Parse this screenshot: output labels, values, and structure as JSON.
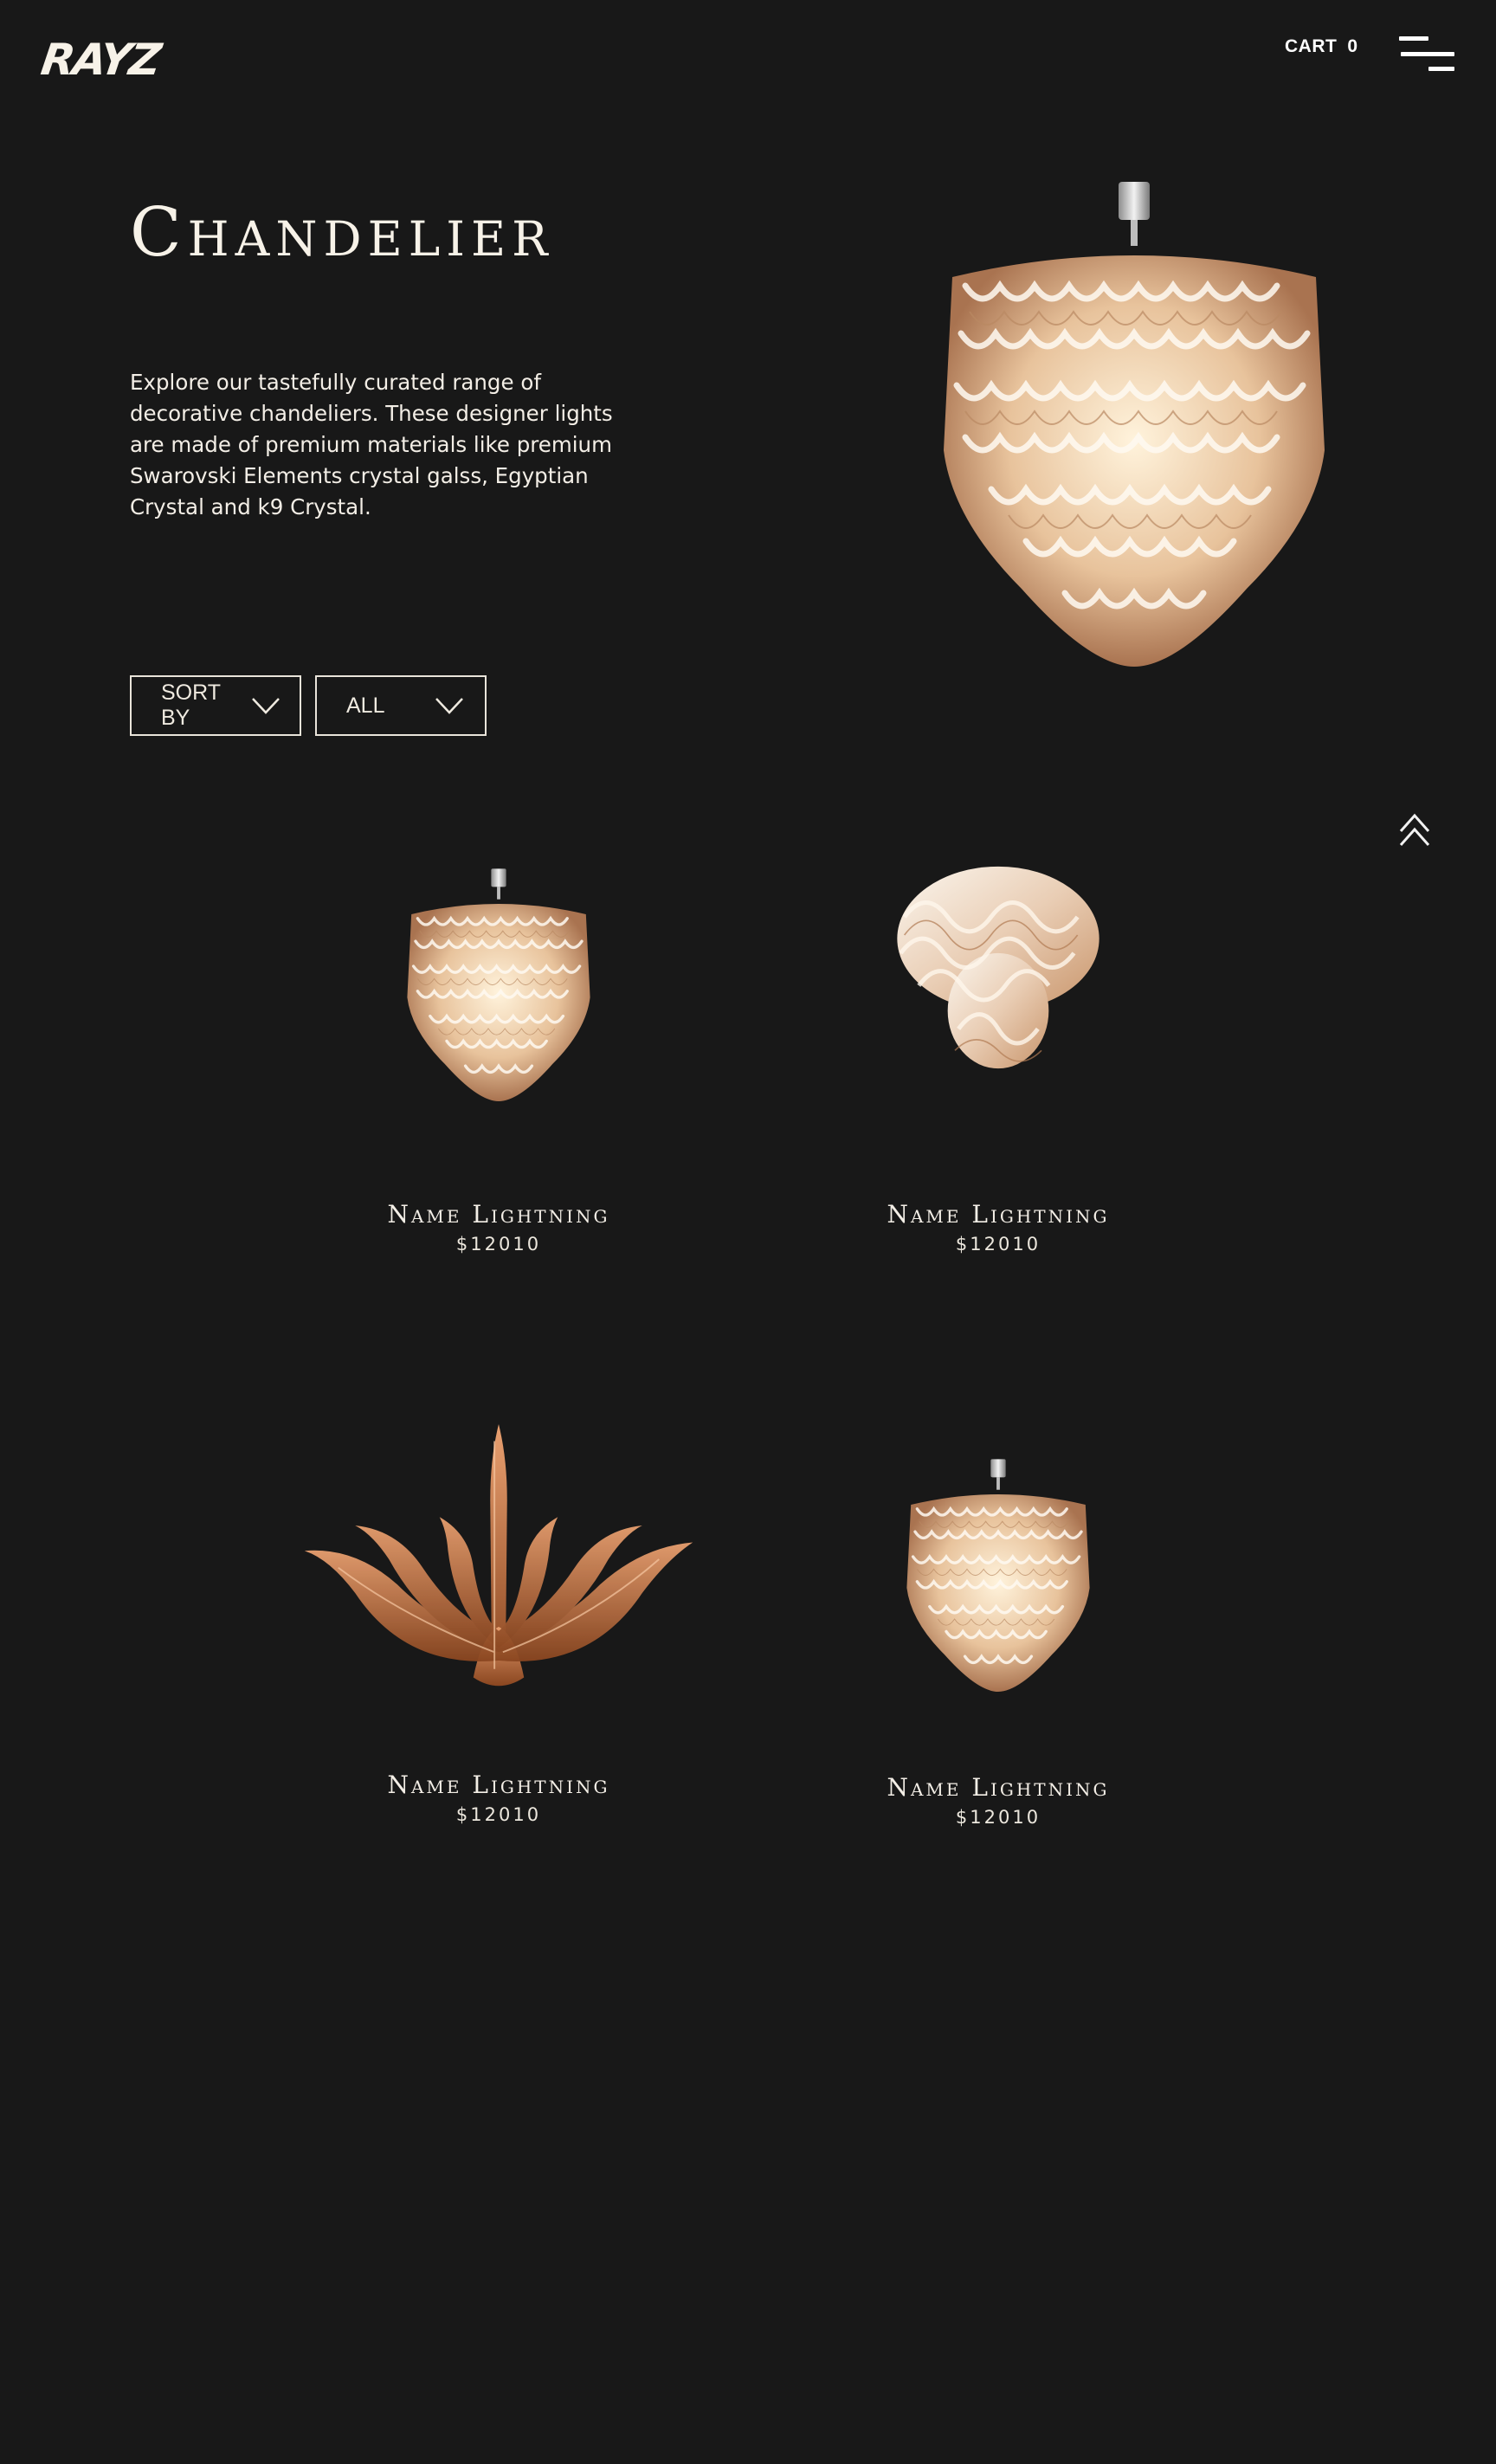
{
  "header": {
    "logo": "RAYZ",
    "cart_label": "CART",
    "cart_count": "0"
  },
  "hero": {
    "title": "Chandelier",
    "description": "Explore our tastefully curated range of decorative chandeliers. These designer lights are made of premium materials like premium Swarovski Elements crystal galss, Egyptian Crystal and k9 Crystal."
  },
  "filters": {
    "sort_label": "SORT BY",
    "category_value": "ALL"
  },
  "products": [
    {
      "name": "Name Lightning",
      "price": "$12010"
    },
    {
      "name": "Name Lightning",
      "price": "$12010"
    },
    {
      "name": "Name Lightning",
      "price": "$12010"
    },
    {
      "name": "Name Lightning",
      "price": "$12010"
    }
  ],
  "colors": {
    "background": "#181818",
    "text": "#f2ede4",
    "crystal_light": "#f4ebe0",
    "crystal_warm": "#d9a57e",
    "amber": "#b8683a"
  }
}
